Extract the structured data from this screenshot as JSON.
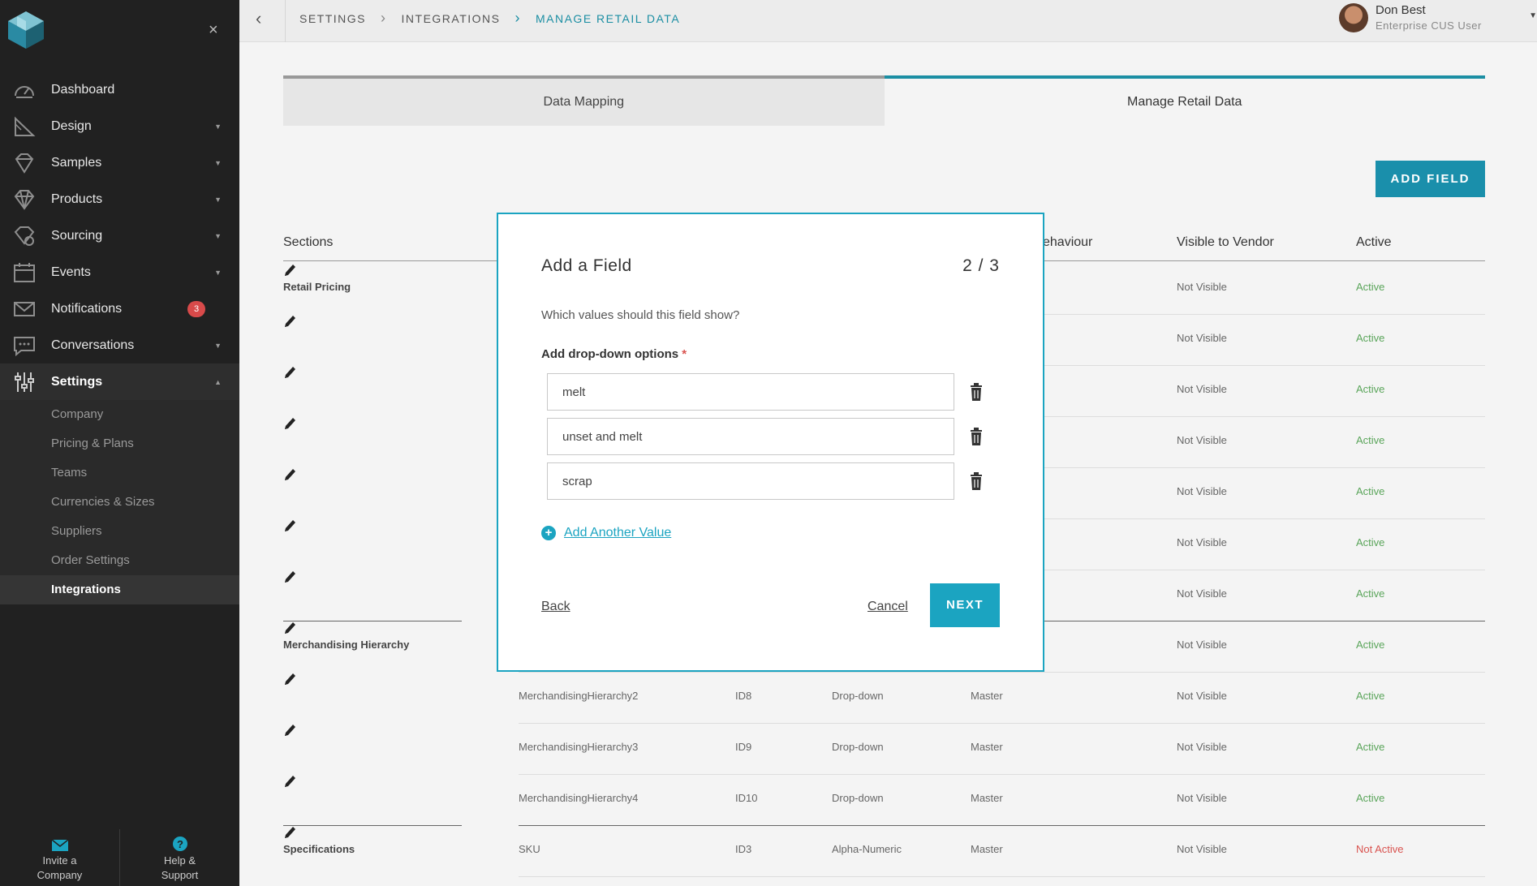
{
  "sidebar": {
    "logo": "cube-logo",
    "close_icon": "×",
    "items": [
      {
        "label": "Dashboard",
        "icon": "dashboard-icon",
        "caret": ""
      },
      {
        "label": "Design",
        "icon": "design-icon",
        "caret": "▼"
      },
      {
        "label": "Samples",
        "icon": "samples-icon",
        "caret": "▼"
      },
      {
        "label": "Products",
        "icon": "products-icon",
        "caret": "▼"
      },
      {
        "label": "Sourcing",
        "icon": "sourcing-icon",
        "caret": "▼"
      },
      {
        "label": "Events",
        "icon": "events-icon",
        "caret": "▼"
      },
      {
        "label": "Notifications",
        "icon": "mail-icon",
        "caret": "",
        "badge": "3"
      },
      {
        "label": "Conversations",
        "icon": "chat-icon",
        "caret": "▼"
      },
      {
        "label": "Settings",
        "icon": "sliders-icon",
        "caret": "▲"
      }
    ],
    "subitems": [
      "Company",
      "Pricing & Plans",
      "Teams",
      "Currencies & Sizes",
      "Suppliers",
      "Order Settings",
      "Integrations"
    ],
    "bottom": {
      "invite_line1": "Invite a",
      "invite_line2": "Company",
      "help_line1": "Help &",
      "help_line2": "Support"
    }
  },
  "topbar": {
    "back": "‹",
    "breadcrumb": [
      "SETTINGS",
      "INTEGRATIONS",
      "MANAGE RETAIL DATA"
    ],
    "user_name": "Don Best",
    "user_role": "Enterprise CUS User"
  },
  "tabs": [
    "Data Mapping",
    "Manage Retail Data"
  ],
  "add_field_label": "ADD FIELD",
  "table": {
    "headers": {
      "sections": "Sections",
      "behaviour": "ehaviour",
      "visible": "Visible to Vendor",
      "active": "Active"
    },
    "rows": [
      {
        "section": "Retail Pricing",
        "name": "",
        "id": "",
        "type": "",
        "behaviour": "",
        "visible": "Not Visible",
        "active": "Active"
      },
      {
        "section": "",
        "name": "",
        "id": "",
        "type": "",
        "behaviour": "",
        "visible": "Not Visible",
        "active": "Active"
      },
      {
        "section": "",
        "name": "",
        "id": "",
        "type": "",
        "behaviour": "",
        "visible": "Not Visible",
        "active": "Active"
      },
      {
        "section": "",
        "name": "",
        "id": "",
        "type": "",
        "behaviour": "",
        "visible": "Not Visible",
        "active": "Active"
      },
      {
        "section": "",
        "name": "",
        "id": "",
        "type": "",
        "behaviour": "",
        "visible": "Not Visible",
        "active": "Active"
      },
      {
        "section": "",
        "name": "",
        "id": "",
        "type": "",
        "behaviour": "",
        "visible": "Not Visible",
        "active": "Active"
      },
      {
        "section": "",
        "name": "",
        "id": "",
        "type": "",
        "behaviour": "",
        "visible": "Not Visible",
        "active": "Active"
      },
      {
        "section": "Merchandising Hierarchy",
        "name": "",
        "id": "",
        "type": "",
        "behaviour": "",
        "visible": "Not Visible",
        "active": "Active"
      },
      {
        "section": "",
        "name": "MerchandisingHierarchy2",
        "id": "ID8",
        "type": "Drop-down",
        "behaviour": "Master",
        "visible": "Not Visible",
        "active": "Active"
      },
      {
        "section": "",
        "name": "MerchandisingHierarchy3",
        "id": "ID9",
        "type": "Drop-down",
        "behaviour": "Master",
        "visible": "Not Visible",
        "active": "Active"
      },
      {
        "section": "",
        "name": "MerchandisingHierarchy4",
        "id": "ID10",
        "type": "Drop-down",
        "behaviour": "Master",
        "visible": "Not Visible",
        "active": "Active"
      },
      {
        "section": "Specifications",
        "name": "SKU",
        "id": "ID3",
        "type": "Alpha-Numeric",
        "behaviour": "Master",
        "visible": "Not Visible",
        "active": "Not Active"
      }
    ]
  },
  "modal": {
    "title": "Add a Field",
    "step": "2 / 3",
    "question": "Which values should this field show?",
    "label": "Add drop-down options",
    "required_mark": "*",
    "options": [
      "melt",
      "unset and melt",
      "scrap"
    ],
    "add_another": "Add Another Value",
    "back": "Back",
    "cancel": "Cancel",
    "next": "NEXT"
  },
  "colors": {
    "accent": "#1ba4c1",
    "sidebar_bg": "#212121",
    "active_green": "#5aa55a",
    "inactive_red": "#d9534f",
    "badge_red": "#d84a4a"
  }
}
